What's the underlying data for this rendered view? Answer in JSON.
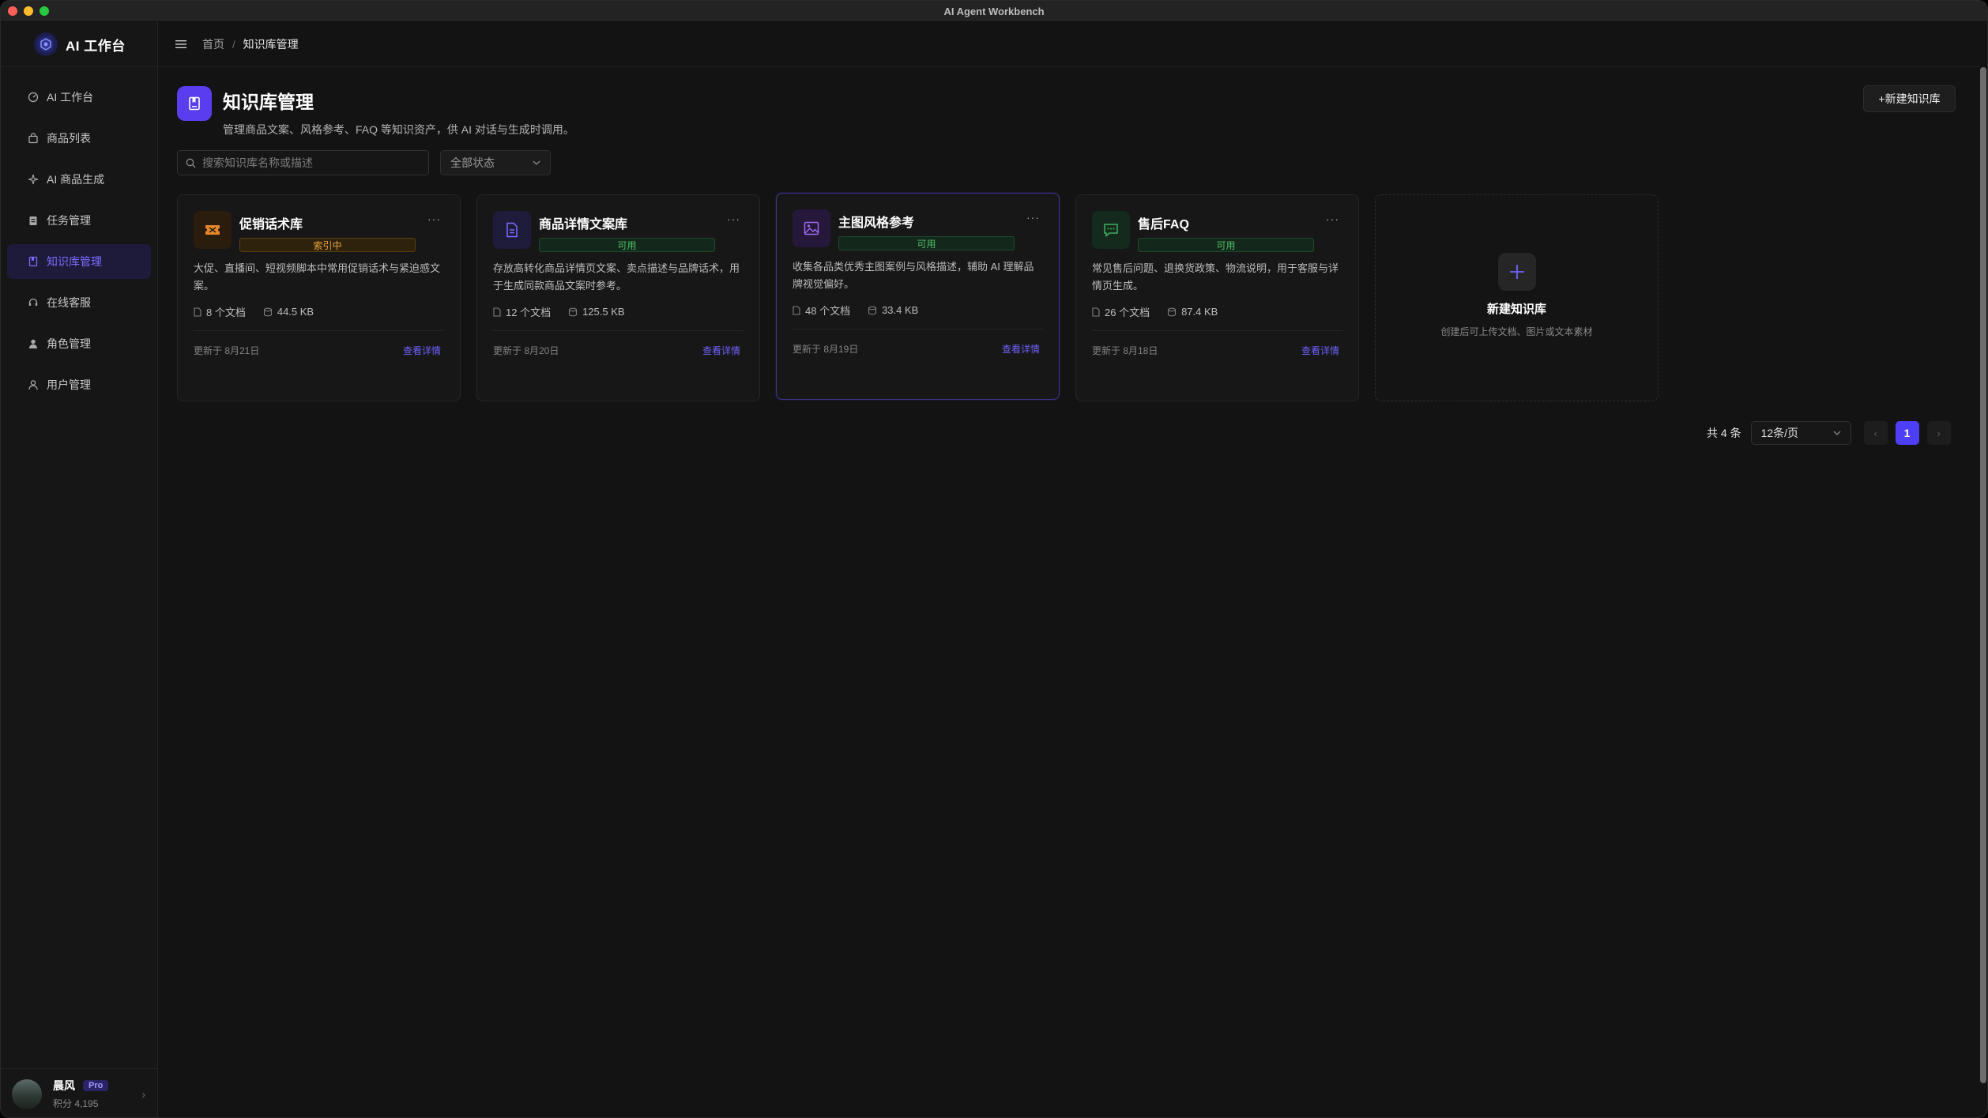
{
  "window": {
    "title": "AI Agent Workbench"
  },
  "brand": {
    "name": "AI 工作台"
  },
  "sidebar": {
    "items": [
      {
        "label": "AI 工作台",
        "icon": "dashboard-icon"
      },
      {
        "label": "商品列表",
        "icon": "shopping-bag-icon"
      },
      {
        "label": "AI 商品生成",
        "icon": "sparkle-icon"
      },
      {
        "label": "任务管理",
        "icon": "clipboard-icon"
      },
      {
        "label": "知识库管理",
        "icon": "book-icon",
        "active": true
      },
      {
        "label": "在线客服",
        "icon": "headset-icon"
      },
      {
        "label": "角色管理",
        "icon": "user-role-icon"
      },
      {
        "label": "用户管理",
        "icon": "user-icon"
      }
    ]
  },
  "user": {
    "name": "晨风",
    "badge": "Pro",
    "points": "积分 4,195"
  },
  "breadcrumb": {
    "home": "首页",
    "separator": "/",
    "current": "知识库管理"
  },
  "page": {
    "title": "知识库管理",
    "description": "管理商品文案、风格参考、FAQ 等知识资产，供 AI 对话与生成时调用。",
    "new_button": "+新建知识库"
  },
  "filters": {
    "search_placeholder": "搜索知识库名称或描述",
    "status_value": "全部状态"
  },
  "cards": [
    {
      "title": "促销话术库",
      "status": "索引中",
      "status_type": "indexing",
      "icon": "ticket-icon",
      "icon_bg": "#2b1d0d",
      "icon_color": "#e6872a",
      "description": "大促、直播间、短视频脚本中常用促销话术与紧迫感文案。",
      "docs": "8 个文档",
      "size": "44.5 KB",
      "updated": "更新于 8月21日",
      "link": "查看详情"
    },
    {
      "title": "商品详情文案库",
      "status": "可用",
      "status_type": "ok",
      "icon": "document-icon",
      "icon_bg": "#1f1c3b",
      "icon_color": "#7a6cff",
      "description": "存放高转化商品详情页文案、卖点描述与品牌话术，用于生成同款商品文案时参考。",
      "docs": "12 个文档",
      "size": "125.5 KB",
      "updated": "更新于 8月20日",
      "link": "查看详情"
    },
    {
      "title": "主图风格参考",
      "status": "可用",
      "status_type": "ok",
      "icon": "image-icon",
      "icon_bg": "#26183a",
      "icon_color": "#9b6cf0",
      "description": "收集各品类优秀主图案例与风格描述，辅助 AI 理解品牌视觉偏好。",
      "docs": "48 个文档",
      "size": "33.4 KB",
      "updated": "更新于 8月19日",
      "link": "查看详情"
    },
    {
      "title": "售后FAQ",
      "status": "可用",
      "status_type": "ok",
      "icon": "chat-icon",
      "icon_bg": "#142a1d",
      "icon_color": "#3fae62",
      "description": "常见售后问题、退换货政策、物流说明，用于客服与详情页生成。",
      "docs": "26 个文档",
      "size": "87.4 KB",
      "updated": "更新于 8月18日",
      "link": "查看详情"
    }
  ],
  "new_card": {
    "title": "新建知识库",
    "subtitle": "创建后可上传文档、图片或文本素材"
  },
  "pagination": {
    "total": "共 4 条",
    "page_size": "12条/页",
    "current_page": "1"
  }
}
